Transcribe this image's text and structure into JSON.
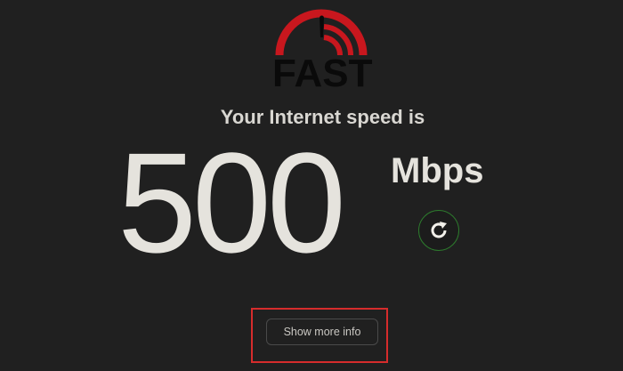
{
  "logo": {
    "text": "FAST",
    "arc_color": "#c8171e",
    "needle_color": "#0a0a0a"
  },
  "result": {
    "headline": "Your Internet speed is",
    "speed": "500",
    "unit": "Mbps"
  },
  "controls": {
    "reload_icon": "reload-icon",
    "more_info_label": "Show more info"
  },
  "colors": {
    "background": "#202020",
    "text": "#e5e3dd",
    "reload_ring": "#2d7a2d",
    "highlight": "#d62c2c"
  }
}
